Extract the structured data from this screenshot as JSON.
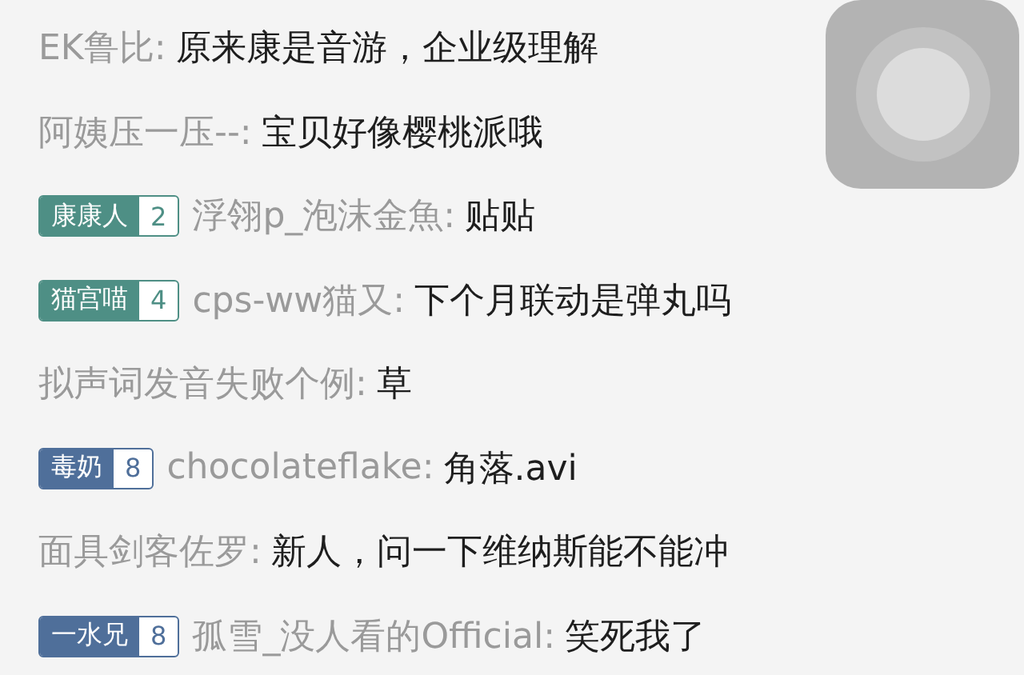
{
  "messages": [
    {
      "user": "EK鲁比:",
      "text": "原来康是音游，企业级理解"
    },
    {
      "user": "阿姨压一压--:",
      "text": "宝贝好像樱桃派哦"
    },
    {
      "medal": {
        "label": "康康人",
        "level": "2",
        "color": "#4e8f85"
      },
      "user": "浮翎p_泡沫金魚:",
      "text": "贴贴"
    },
    {
      "medal": {
        "label": "猫宫喵",
        "level": "4",
        "color": "#4e8f85"
      },
      "user": "cps-ww猫又:",
      "text": "下个月联动是弹丸吗"
    },
    {
      "user": "拟声词发音失败个例:",
      "text": "草"
    },
    {
      "medal": {
        "label": "毒奶",
        "level": "8",
        "color": "#4f6f9a"
      },
      "user": "chocolateflake:",
      "text": "角落.avi"
    },
    {
      "user": "面具剑客佐罗:",
      "text": "新人，问一下维纳斯能不能冲"
    },
    {
      "medal": {
        "label": "一水兄",
        "level": "8",
        "color": "#4f6f9a"
      },
      "user": "孤雪_没人看的Official:",
      "text": "笑死我了"
    }
  ]
}
